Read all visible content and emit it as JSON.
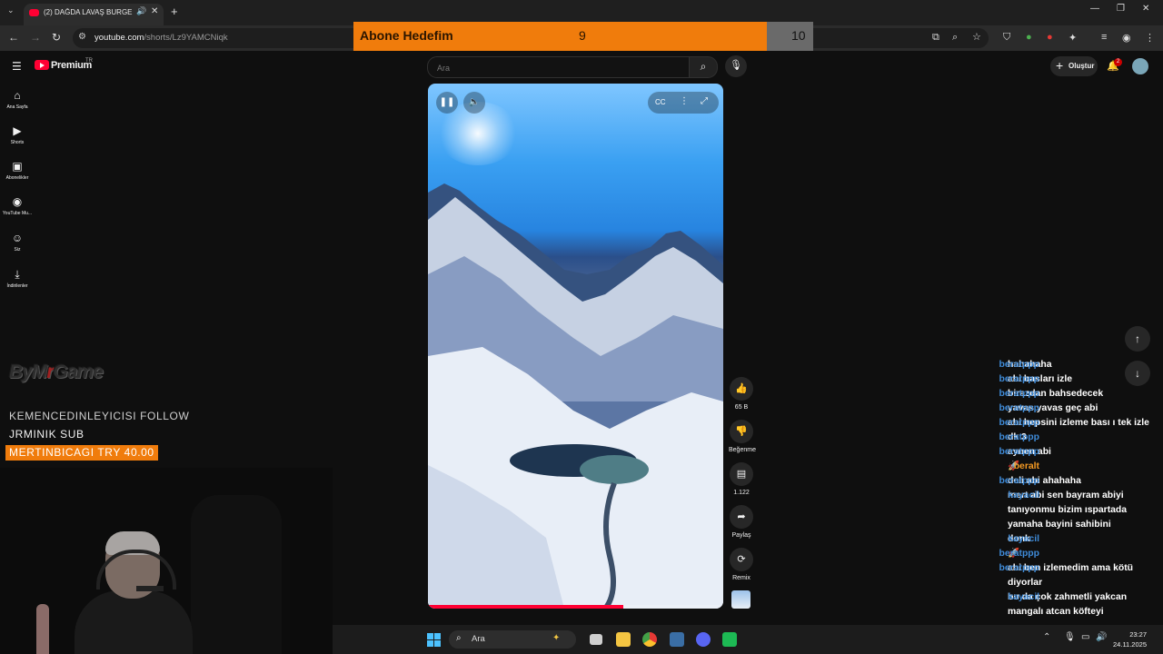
{
  "browser": {
    "tab_title": "(2) DAĞDA LAVAŞ BURGER ...",
    "url_host": "youtube.com",
    "url_path": "/shorts/Lz9YAMCNiqk"
  },
  "goal_bar": {
    "label": "Abone Hedefim",
    "current": "9",
    "target": "10",
    "progress": 0.9
  },
  "youtube": {
    "logo_text": "Premium",
    "region": "TR",
    "search_placeholder": "Ara",
    "create_label": "Oluştur",
    "notification_count": "2",
    "sidebar": [
      {
        "label": "Ana Sayfa",
        "icon": "home-icon",
        "glyph": "⌂"
      },
      {
        "label": "Shorts",
        "icon": "shorts-icon",
        "glyph": "▶"
      },
      {
        "label": "Abonelikler",
        "icon": "subscriptions-icon",
        "glyph": "▣"
      },
      {
        "label": "YouTube Mu...",
        "icon": "music-icon",
        "glyph": "◉"
      },
      {
        "label": "Siz",
        "icon": "user-icon",
        "glyph": "☺"
      },
      {
        "label": "İndirilenler",
        "icon": "download-icon",
        "glyph": "⤓"
      }
    ],
    "actions": {
      "like_count": "65 B",
      "dislike_label": "Beğenme",
      "comment_count": "1.122",
      "share_label": "Paylaş",
      "remix_label": "Remix"
    },
    "video_progress": 0.66
  },
  "stream": {
    "logo": {
      "a": "ByM",
      "b": "r",
      "c": "Game"
    },
    "alerts": [
      {
        "text": "KEMENCEDINLEYICISI  FOLLOW"
      },
      {
        "text": "JRMINIK  SUB"
      },
      {
        "text": "MERTINBICAGI  TRY 40.00"
      }
    ]
  },
  "chat": [
    {
      "user": "beratppp",
      "text": "hahahaha",
      "color": "blue"
    },
    {
      "user": "beratppp",
      "text": "abi basları izle",
      "color": "blue"
    },
    {
      "user": "beratppp",
      "text": "birazdan bahsedecek",
      "color": "blue"
    },
    {
      "user": "beratppp",
      "text": "yavas yavas geç abi",
      "color": "blue"
    },
    {
      "user": "beratppp",
      "text": "abi hepsini izleme bası ı tek izle",
      "color": "blue"
    },
    {
      "user": "beratppp",
      "text": "dk 3",
      "color": "blue"
    },
    {
      "user": "beratppp",
      "text": "aynen abi",
      "color": "blue"
    },
    {
      "user": "beralt",
      "text": "🚀",
      "color": "orange"
    },
    {
      "user": "beratppp",
      "text": "deli abi ahahaha",
      "color": "blue"
    },
    {
      "user": "kayacil",
      "text": "mert abi sen bayram abiyi tanıyonmu bizim ıspartada yamaha bayini sahibini",
      "color": "blue"
    },
    {
      "user": "kayacil",
      "text": "donk",
      "color": "blue"
    },
    {
      "user": "beratppp",
      "text": "🚀",
      "color": "blue"
    },
    {
      "user": "beratppp",
      "text": "abi ben izlemedim ama kötü diyorlar",
      "color": "blue"
    },
    {
      "user": "kayacil",
      "text": "bu da çok zahmetli yakcan mangalı atcan köfteyi",
      "color": "blue"
    }
  ],
  "taskbar": {
    "search_placeholder": "Ara",
    "time": "23:27",
    "date": "24.11.2025"
  }
}
